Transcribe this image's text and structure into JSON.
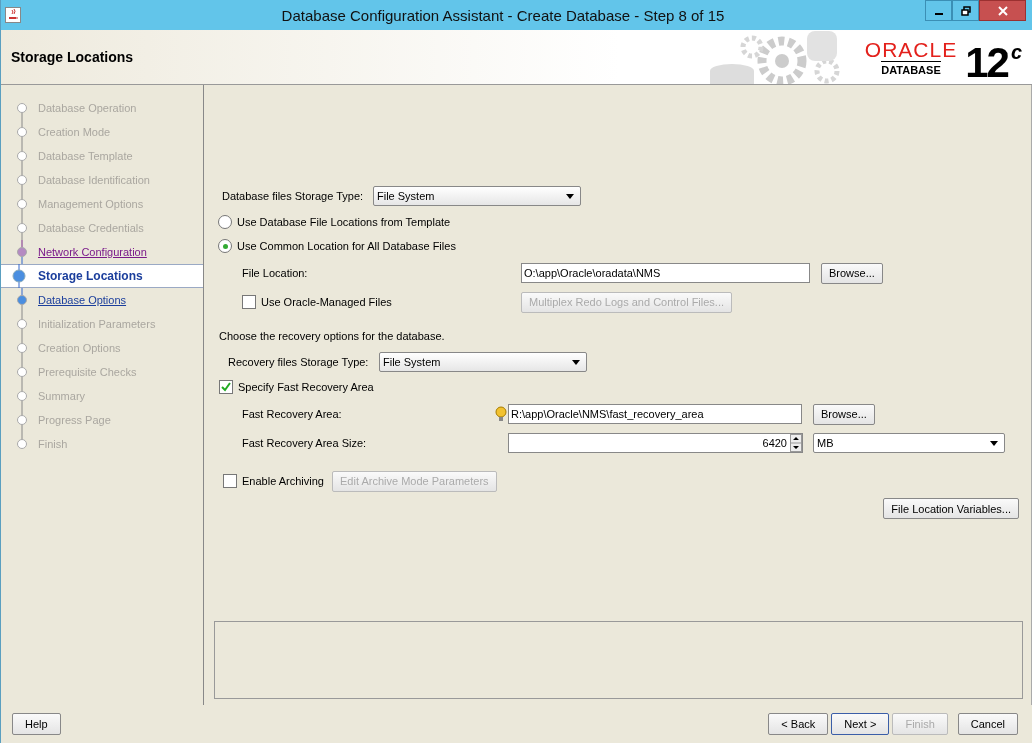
{
  "window": {
    "title": "Database Configuration Assistant - Create Database - Step 8 of 15"
  },
  "header": {
    "title": "Storage Locations",
    "logo": {
      "brand": "ORACLE",
      "product": "DATABASE",
      "version": "12",
      "version_suffix": "c"
    }
  },
  "steps": [
    {
      "label": "Database Operation",
      "kind": "done",
      "selected": false
    },
    {
      "label": "Creation Mode",
      "kind": "done",
      "selected": false
    },
    {
      "label": "Database Template",
      "kind": "done",
      "selected": false
    },
    {
      "label": "Database Identification",
      "kind": "done",
      "selected": false
    },
    {
      "label": "Management Options",
      "kind": "done",
      "selected": false
    },
    {
      "label": "Database Credentials",
      "kind": "done",
      "selected": false
    },
    {
      "label": "Network Configuration",
      "kind": "visited",
      "selected": false
    },
    {
      "label": "Storage Locations",
      "kind": "current",
      "selected": true
    },
    {
      "label": "Database Options",
      "kind": "link",
      "selected": false
    },
    {
      "label": "Initialization Parameters",
      "kind": "pending",
      "selected": false
    },
    {
      "label": "Creation Options",
      "kind": "pending",
      "selected": false
    },
    {
      "label": "Prerequisite Checks",
      "kind": "pending",
      "selected": false
    },
    {
      "label": "Summary",
      "kind": "pending",
      "selected": false
    },
    {
      "label": "Progress Page",
      "kind": "pending",
      "selected": false
    },
    {
      "label": "Finish",
      "kind": "pending",
      "selected": false
    }
  ],
  "db_storage": {
    "label": "Database files Storage Type:",
    "value": "File System"
  },
  "location_options": [
    {
      "label": "Use Database File Locations from Template",
      "selected": false
    },
    {
      "label": "Use Common Location for All Database Files",
      "selected": true
    }
  ],
  "file_location": {
    "label": "File Location:",
    "value": "O:\\app\\Oracle\\oradata\\NMS",
    "button": "Browse..."
  },
  "oracle_managed": {
    "label": "Use Oracle-Managed Files",
    "checked": false,
    "button": "Multiplex Redo Logs and Control Files...",
    "button_disabled": true
  },
  "recovery_intro": "Choose the recovery options for the database.",
  "recovery_storage": {
    "label": "Recovery files Storage Type:",
    "value": "File System"
  },
  "fast_recovery": {
    "label": "Specify Fast Recovery Area",
    "checked": true
  },
  "fra_location": {
    "label": "Fast Recovery Area:",
    "value": "R:\\app\\Oracle\\NMS\\fast_recovery_area",
    "button": "Browse..."
  },
  "fra_size": {
    "label": "Fast Recovery Area Size:",
    "value": "6420",
    "unit": "MB"
  },
  "archiving": {
    "label": "Enable Archiving",
    "checked": false,
    "button": "Edit Archive Mode Parameters",
    "button_disabled": true
  },
  "variables_button": "File Location Variables...",
  "footer": {
    "help": "Help",
    "back": "< Back",
    "next": "Next >",
    "finish": "Finish",
    "finish_disabled": true,
    "cancel": "Cancel"
  }
}
